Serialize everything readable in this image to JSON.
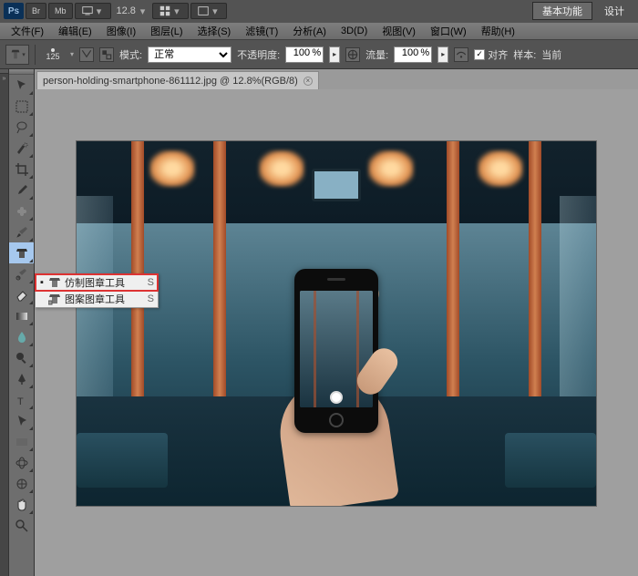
{
  "topbar": {
    "logo": "Ps",
    "br": "Br",
    "mb": "Mb",
    "zoom": "12.8",
    "basic": "基本功能",
    "design": "设计"
  },
  "menu": {
    "file": "文件(F)",
    "edit": "编辑(E)",
    "image": "图像(I)",
    "layer": "图层(L)",
    "select": "选择(S)",
    "filter": "滤镜(T)",
    "analysis": "分析(A)",
    "three_d": "3D(D)",
    "view": "视图(V)",
    "window": "窗口(W)",
    "help": "帮助(H)"
  },
  "opt": {
    "brush_size": "125",
    "mode_label": "模式:",
    "mode_value": "正常",
    "opacity_label": "不透明度:",
    "opacity_value": "100",
    "flow_label": "流量:",
    "flow_value": "100",
    "aligned_label": "对齐",
    "sample_label": "样本:",
    "sample_value": "当前"
  },
  "tab": {
    "title": "person-holding-smartphone-861112.jpg @ 12.8%(RGB/8)",
    "close": "×"
  },
  "flyout": {
    "item1": {
      "label": "仿制图章工具",
      "key": "S"
    },
    "item2": {
      "label": "图案图章工具",
      "key": "S"
    }
  },
  "colors": {
    "highlight": "#d33",
    "selected_tool_bg": "#a6c8ee"
  }
}
